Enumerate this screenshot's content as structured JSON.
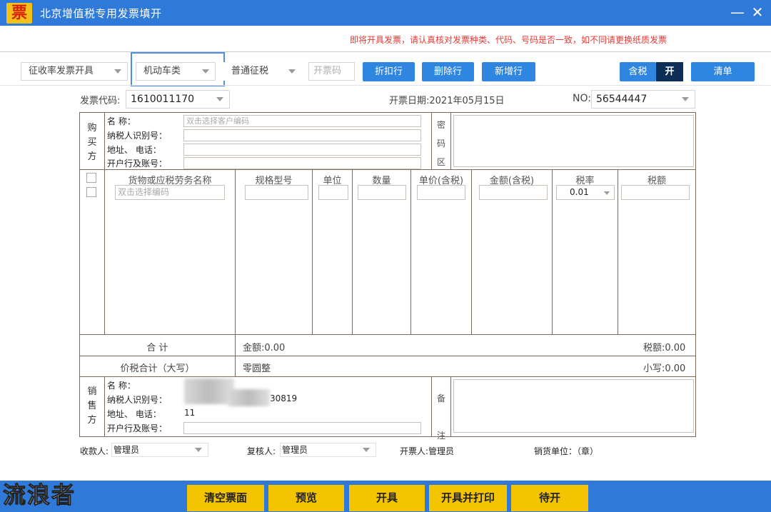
{
  "window": {
    "icon_char": "票",
    "title": "北京增值税专用发票填开",
    "minimize": "—",
    "close": "✕"
  },
  "notice": "即将开具发票，请认真核对发票种类、代码、号码是否一致，如不同请更换纸质发票",
  "toolbar": {
    "issue_type": "征收率发票开具",
    "invoice_category": "机动车类",
    "tax_type": "普通征税",
    "code_placeholder": "开票码",
    "discount_label": "折扣行",
    "delete_label": "删除行",
    "add_label": "新增行",
    "tax_incl_label": "含税",
    "tax_toggle_label": "开",
    "list_label": "清单"
  },
  "header": {
    "code_label": "发票代码:",
    "code_value": "1610011170",
    "date_label": "开票日期:",
    "date_value": "2021年05月15日",
    "no_label": "NO:",
    "no_value": "56544447"
  },
  "buyer": {
    "section_label": [
      "购",
      "买",
      "方"
    ],
    "name_label": "名          称：",
    "name_placeholder": "双击选择客户编码",
    "taxid_label": "纳税人识别号：",
    "address_label": "地址、    电话：",
    "bank_label": "开户行及账号：",
    "cipher_label": [
      "密",
      "码",
      "区"
    ]
  },
  "items": {
    "columns": [
      "货物或应税劳务名称",
      "规格型号",
      "单位",
      "数量",
      "单价(含税)",
      "金额(含税)",
      "税率",
      "税额"
    ],
    "name_placeholder": "双击选择编码",
    "tax_rate": "0.01"
  },
  "totals": {
    "total_label": "合          计",
    "amount_label": "金额:0.00",
    "tax_label": "税额:0.00",
    "sum_label": "价税合计（大写）",
    "sum_upper": "零圆整",
    "sum_lower": "小写:0.00"
  },
  "seller": {
    "section_label": [
      "销",
      "售",
      "方"
    ],
    "name_label": "名          称：",
    "taxid_label": "纳税人识别号：",
    "taxid_visible_tail": "30819",
    "address_label": "地址、    电话：",
    "address_value": "11",
    "bank_label": "开户行及账号：",
    "remark_label": [
      "备",
      "注"
    ]
  },
  "signers": {
    "payee_label": "收款人:",
    "payee_value": "管理员",
    "reviewer_label": "复核人:",
    "reviewer_value": "管理员",
    "drawer_label": "开票人:",
    "drawer_value": "管理员",
    "seller_unit_label": "销货单位：（章）"
  },
  "actions": {
    "clear_label": "清空票面",
    "preview_label": "预览",
    "issue_label": "开具",
    "issue_print_label": "开具并打印",
    "pending_label": "待开"
  },
  "watermark": "流浪者",
  "colors": {
    "accent_blue": "#2f7ad8",
    "button_blue": "#2e86e0",
    "button_yellow": "#f5c400",
    "notice_red": "#e53935",
    "form_line": "#7a6a5c"
  }
}
